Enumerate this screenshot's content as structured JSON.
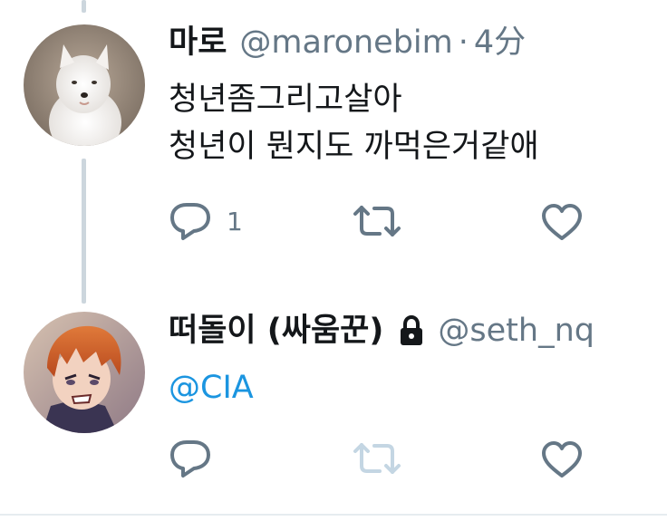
{
  "tweets": [
    {
      "display_name": "마로",
      "handle": "@maronebim",
      "separator": "·",
      "time": "4分",
      "lines": [
        "청년좀그리고살아",
        "청년이 뭔지도 까먹은거같애"
      ],
      "reply_count": "1",
      "avatar": "white-dog-photo"
    },
    {
      "display_name": "떠돌이 (싸움꾼)",
      "handle": "@seth_nq",
      "mention": "@CIA",
      "protected": true,
      "avatar": "anime-character-illustration"
    }
  ],
  "colors": {
    "text": "#14171a",
    "secondary": "#657786",
    "link": "#1b95e0",
    "thread_line": "#ccd6dd",
    "disabled_retweet": "#c4d6e3"
  }
}
